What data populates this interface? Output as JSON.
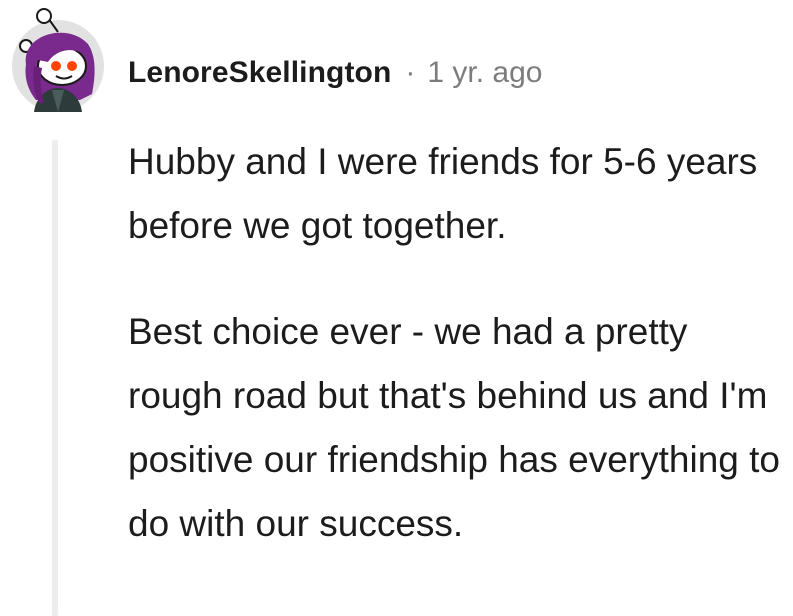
{
  "comment": {
    "author": "LenoreSkellington",
    "separator": "·",
    "timestamp": "1 yr. ago",
    "paragraphs": [
      "Hubby and I were friends for 5-6 years before we got together.",
      "Best choice ever - we had a pretty rough road but that's behind us and I'm positive our friendship has everything to do with our success."
    ],
    "avatar_icon": "reddit-snoo-avatar-icon"
  },
  "colors": {
    "text": "#1c1c1c",
    "meta": "#7c7c7c",
    "thread_line": "#ededed",
    "avatar_bg": "#e2e2e2",
    "hair": "#7a2a8c",
    "eyes": "#ff4500"
  }
}
